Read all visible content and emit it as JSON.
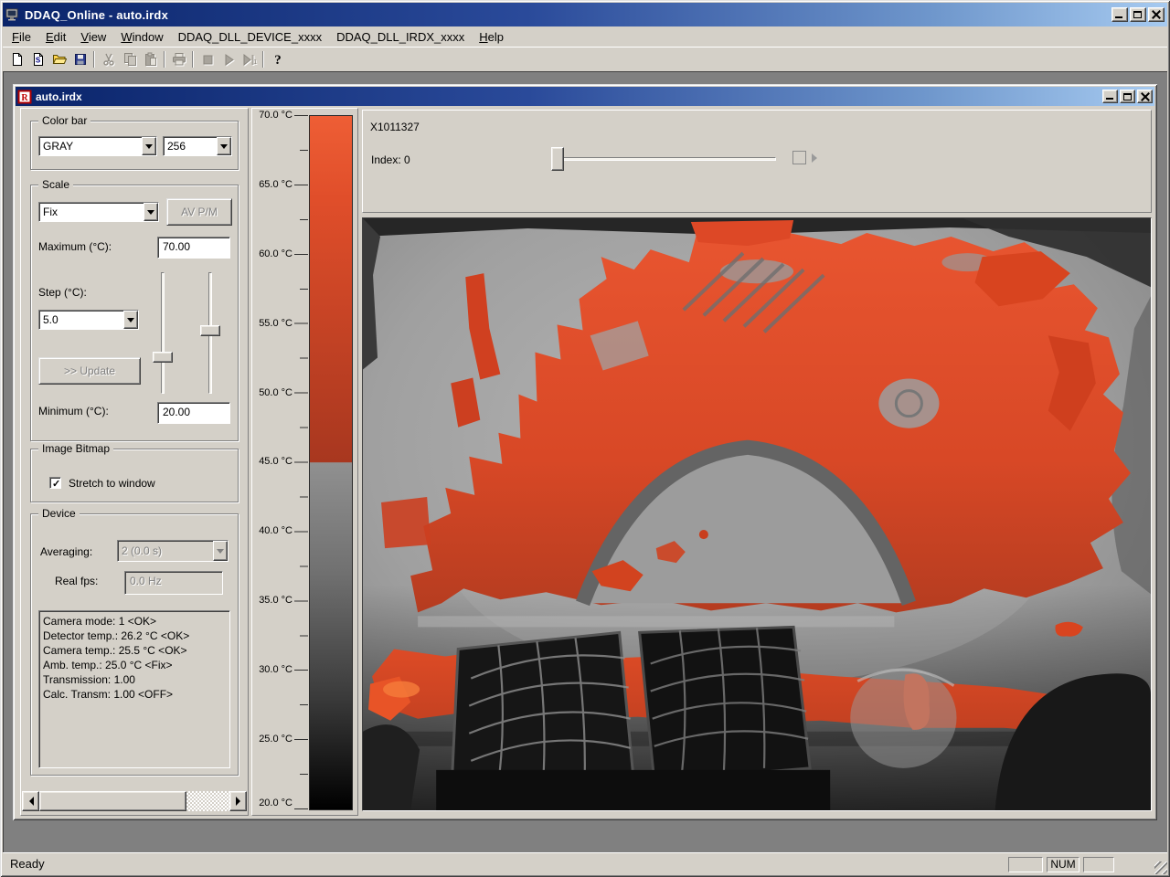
{
  "window": {
    "title": "DDAQ_Online - auto.irdx"
  },
  "menu": {
    "items": [
      {
        "label": "File"
      },
      {
        "label": "Edit"
      },
      {
        "label": "View"
      },
      {
        "label": "Window"
      },
      {
        "label": "DDAQ_DLL_DEVICE_xxxx"
      },
      {
        "label": "DDAQ_DLL_IRDX_xxxx"
      },
      {
        "label": "Help"
      }
    ]
  },
  "toolbar": {
    "icons": [
      "new-document",
      "script-document",
      "open-folder",
      "save",
      "cut",
      "copy",
      "paste",
      "print",
      "stop",
      "play",
      "play-single",
      "help"
    ]
  },
  "child_window": {
    "title": "auto.irdx"
  },
  "controls": {
    "color_bar": {
      "legend": "Color bar",
      "palette": "GRAY",
      "levels": "256"
    },
    "scale": {
      "legend": "Scale",
      "mode": "Fix",
      "avpm": "AV P/M",
      "maximum_label": "Maximum (°C):",
      "maximum": "70.00",
      "step_label": "Step (°C):",
      "step": "5.0",
      "update": ">> Update",
      "minimum_label": "Minimum (°C):",
      "minimum": "20.00"
    },
    "image_bitmap": {
      "legend": "Image Bitmap",
      "stretch": "Stretch to window",
      "stretch_checked": true
    },
    "device": {
      "legend": "Device",
      "averaging_label": "Averaging:",
      "averaging": "2 (0.0 s)",
      "fps_label": "Real fps:",
      "fps": "0.0 Hz",
      "status_lines": [
        "Camera mode: 1 <OK>",
        "Detector temp.: 26.2 °C <OK>",
        "Camera temp.: 25.5 °C <OK>",
        "Amb. temp.: 25.0 °C <Fix>",
        "Transmission: 1.00",
        "Calc. Transm: 1.00 <OFF>"
      ]
    }
  },
  "color_scale": {
    "tick_labels": [
      "70.0 °C",
      "65.0 °C",
      "60.0 °C",
      "55.0 °C",
      "50.0 °C",
      "45.0 °C",
      "40.0 °C",
      "35.0 °C",
      "30.0 °C",
      "25.0 °C",
      "20.0 °C"
    ],
    "red_top": "#ee5e35",
    "red_bottom": "#a8371f",
    "gray_top": "#909090",
    "gray_bottom": "#000000",
    "red_gray_threshold": "45.0 °C"
  },
  "viewer": {
    "camera_id": "X1011327",
    "index_label": "Index: 0"
  },
  "status_bar": {
    "message": "Ready",
    "num_indicator": "NUM"
  },
  "colors": {
    "titlebar_left": "#0a246a",
    "titlebar_right": "#a6caf0",
    "window_face": "#d4d0c8",
    "mdi_background": "#808080",
    "hot_color": "#e04e2a"
  }
}
